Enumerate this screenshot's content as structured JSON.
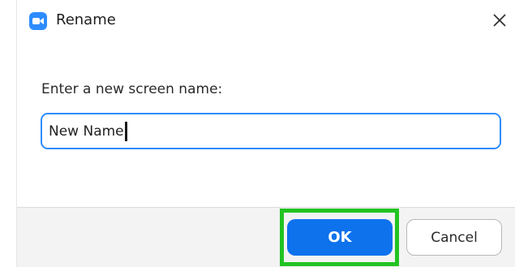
{
  "dialog": {
    "title": "Rename",
    "app_icon": "zoom-camera-icon",
    "close_icon": "close-icon",
    "accent_color": "#2d8cff",
    "prompt": "Enter a new screen name:",
    "input_value": "New Name",
    "highlight_color": "#22c322",
    "buttons": {
      "ok": "OK",
      "cancel": "Cancel"
    }
  }
}
